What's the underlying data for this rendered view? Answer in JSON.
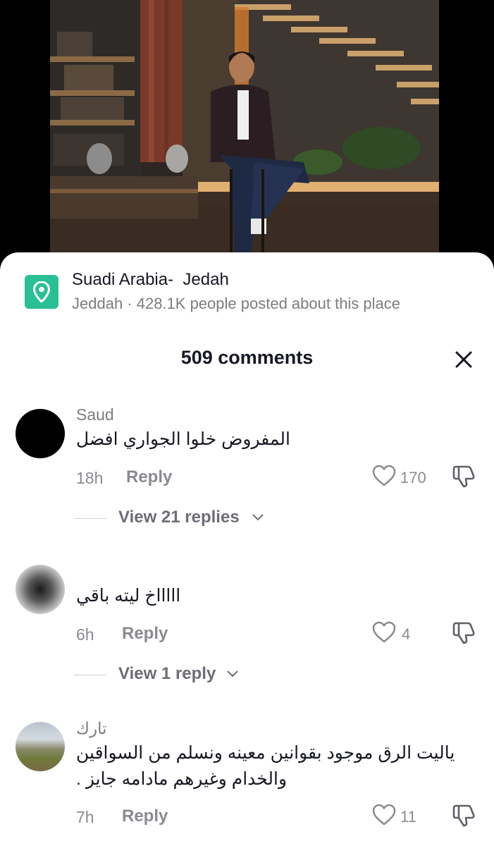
{
  "place": {
    "title": "Suadi Arabia-  Jedah",
    "subtitle": "Jeddah · 428.1K people posted about this place",
    "icon": "location-pin-icon",
    "icon_color": "#2bbf94"
  },
  "comments_header": {
    "count_label": "509 comments",
    "close_icon": "close-icon"
  },
  "comments": [
    {
      "username": "Saud",
      "text": "المفروض خلوا الجواري افضل",
      "time": "18h",
      "reply_label": "Reply",
      "likes": "170",
      "view_replies": "View 21 replies"
    },
    {
      "username": "",
      "text": "اااااخ ليته باقي",
      "time": "6h",
      "reply_label": "Reply",
      "likes": "4",
      "view_replies": "View 1 reply"
    },
    {
      "username": "تارك",
      "text": "ياليت الرق موجود بقوانين معينه ونسلم من السواقين والخدام وغيرهم مادامه جايز .",
      "time": "7h",
      "reply_label": "Reply",
      "likes": "11"
    }
  ]
}
